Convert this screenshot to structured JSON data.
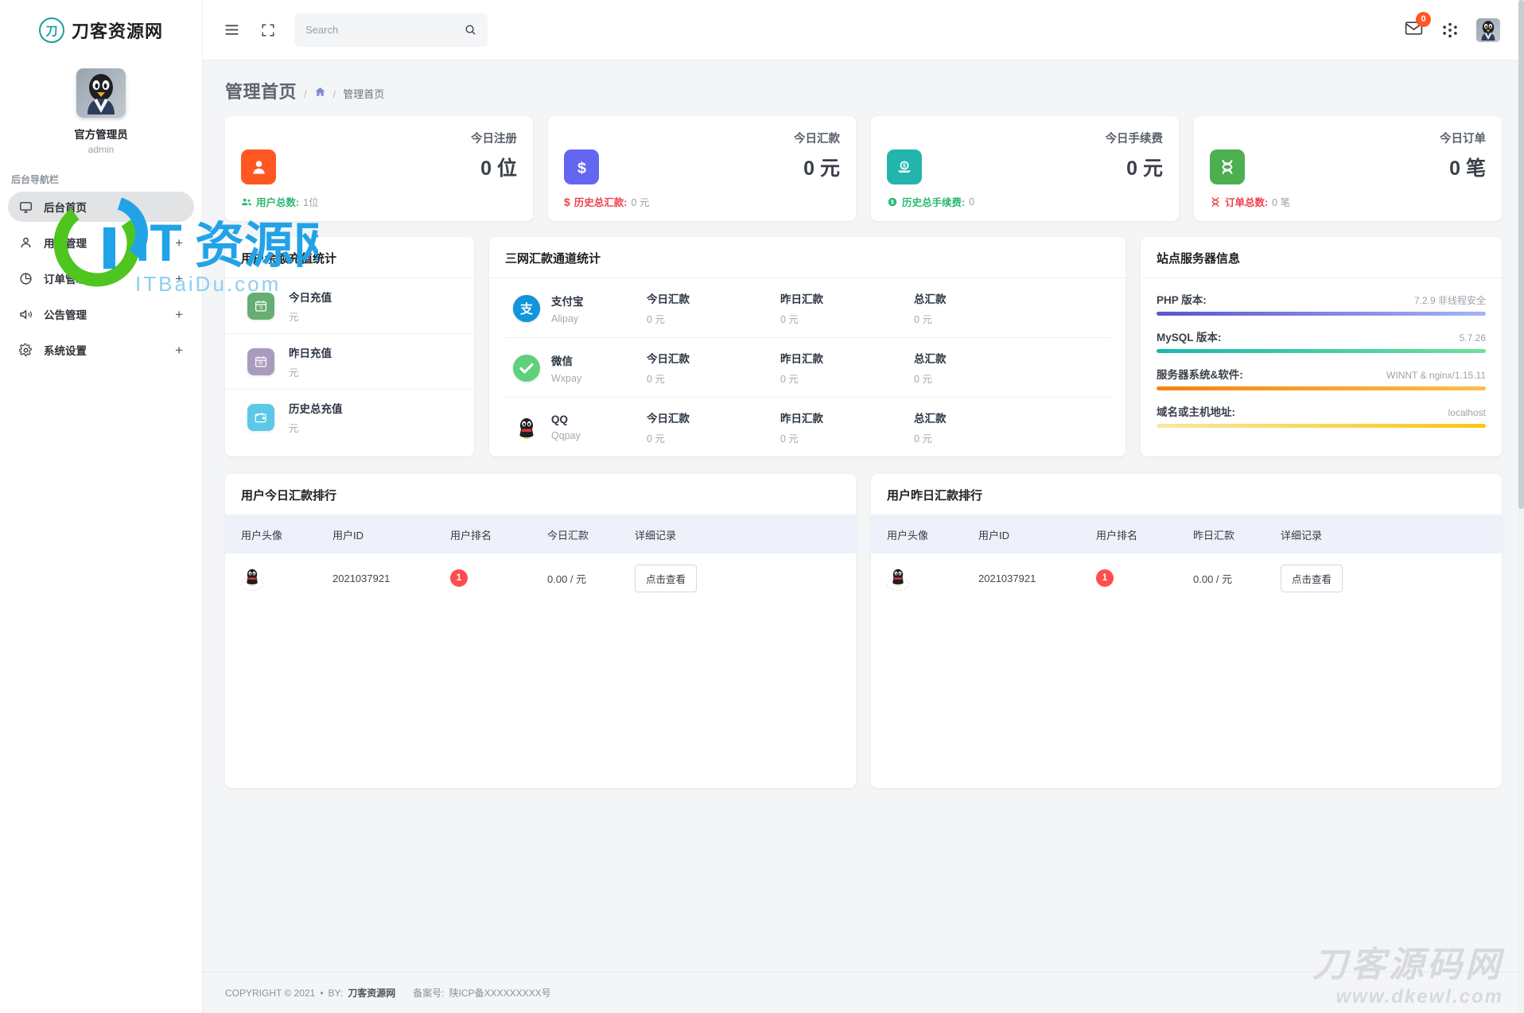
{
  "brand": {
    "name": "刀客资源网",
    "mark": "刀"
  },
  "profile": {
    "name": "官方管理员",
    "username": "admin"
  },
  "sidebar": {
    "nav_title": "后台导航栏",
    "items": [
      {
        "label": "后台首页",
        "icon": "monitor-icon",
        "expandable": false,
        "active": true
      },
      {
        "label": "用户管理",
        "icon": "user-icon",
        "expandable": true,
        "active": false
      },
      {
        "label": "订单管理",
        "icon": "pie-chart-icon",
        "expandable": true,
        "active": false
      },
      {
        "label": "公告管理",
        "icon": "megaphone-icon",
        "expandable": true,
        "active": false
      },
      {
        "label": "系统设置",
        "icon": "gear-icon",
        "expandable": true,
        "active": false
      }
    ],
    "expand_symbol": "+"
  },
  "topbar": {
    "menu_icon": "hamburger-icon",
    "fullscreen_icon": "fullscreen-icon",
    "search": {
      "placeholder": "Search",
      "value": "",
      "icon": "search-icon"
    },
    "mail": {
      "icon": "mail-icon",
      "badge": "0"
    },
    "apps_icon": "apps-icon",
    "avatar": "qq-penguin-avatar"
  },
  "page": {
    "title": "管理首页",
    "breadcrumb": {
      "home_icon": "home-icon",
      "sep": "/",
      "current": "管理首页"
    }
  },
  "stats": [
    {
      "label": "今日注册",
      "value": "0 位",
      "icon": "user-solid-icon",
      "color": "#ff5722",
      "foot_icon": "users-group-icon",
      "foot_label": "用户总数:",
      "foot_value": "1位",
      "foot_color": "#2eb872"
    },
    {
      "label": "今日汇款",
      "value": "0 元",
      "icon": "dollar-icon",
      "color": "#6366f1",
      "foot_icon": "dollar-sign-icon",
      "foot_label": "历史总汇款:",
      "foot_value": "0 元",
      "foot_color": "#f1404b"
    },
    {
      "label": "今日手续费",
      "value": "0 元",
      "icon": "coin-stack-icon",
      "color": "#23b5ad",
      "foot_icon": "coin-icon",
      "foot_label": "历史总手续费:",
      "foot_value": "0",
      "foot_color": "#2eb872"
    },
    {
      "label": "今日订单",
      "value": "0 笔",
      "icon": "dna-icon",
      "color": "#4caf50",
      "foot_icon": "dna-small-icon",
      "foot_label": "订单总数:",
      "foot_value": "0 笔",
      "foot_color": "#f1404b"
    }
  ],
  "recharge_card": {
    "title": "用户余额充值统计",
    "rows": [
      {
        "name": "今日充值",
        "unit": "元",
        "icon": "calendar-today-icon",
        "color": "#67ae72"
      },
      {
        "name": "昨日充值",
        "unit": "元",
        "icon": "calendar-yesterday-icon",
        "color": "#a99bbd"
      },
      {
        "name": "历史总充值",
        "unit": "元",
        "icon": "wallet-icon",
        "color": "#5bc8e8"
      }
    ]
  },
  "channel_card": {
    "title": "三网汇款通道统计",
    "columns": [
      "今日汇款",
      "昨日汇款",
      "总汇款"
    ],
    "rows": [
      {
        "name": "支付宝",
        "code": "Alipay",
        "logo": "alipay-icon",
        "color": "#1296db",
        "values": [
          "0 元",
          "0 元",
          "0 元"
        ]
      },
      {
        "name": "微信",
        "code": "Wxpay",
        "logo": "wechat-icon",
        "color": "#5ed07a",
        "values": [
          "0 元",
          "0 元",
          "0 元"
        ]
      },
      {
        "name": "QQ",
        "code": "Qqpay",
        "logo": "qq-penguin-icon",
        "color": "#ffffff",
        "values": [
          "0 元",
          "0 元",
          "0 元"
        ]
      }
    ]
  },
  "server_card": {
    "title": "站点服务器信息",
    "items": [
      {
        "key": "PHP 版本:",
        "value": "7.2.9 非线程安全",
        "bar_from": "#5b56c8",
        "bar_to": "#a6b4f5"
      },
      {
        "key": "MySQL 版本:",
        "value": "5.7.26",
        "bar_from": "#16b8b0",
        "bar_to": "#6ee09a"
      },
      {
        "key": "服务器系统&软件:",
        "value": "WINNT & nginx/1.15.11",
        "bar_from": "#f7820d",
        "bar_to": "#fcc04a"
      },
      {
        "key": "域名或主机地址:",
        "value": "localhost",
        "bar_from": "#f7e9a0",
        "bar_to": "#fbc513"
      }
    ]
  },
  "rank_today": {
    "title": "用户今日汇款排行",
    "columns": [
      "用户头像",
      "用户ID",
      "用户排名",
      "今日汇款",
      "详细记录"
    ],
    "rows": [
      {
        "avatar": "qq-penguin-avatar",
        "user_id": "2021037921",
        "rank": "1",
        "amount": "0.00 / 元",
        "action": "点击查看"
      }
    ]
  },
  "rank_yesterday": {
    "title": "用户昨日汇款排行",
    "columns": [
      "用户头像",
      "用户ID",
      "用户排名",
      "昨日汇款",
      "详细记录"
    ],
    "rows": [
      {
        "avatar": "qq-penguin-avatar",
        "user_id": "2021037921",
        "rank": "1",
        "amount": "0.00 / 元",
        "action": "点击查看"
      }
    ]
  },
  "footer": {
    "copyright": "COPYRIGHT © 2021",
    "dot": "•",
    "by_label": "BY:",
    "by_name": "刀客资源网",
    "icp_label": "备案号:",
    "icp_value": "陕ICP备XXXXXXXXX号"
  },
  "watermarks": {
    "it": {
      "text": "IT资源网",
      "sub": "ITBaiDu.com"
    },
    "dk": {
      "line1": "刀客源码网",
      "line2": "www.dkewl.com"
    }
  }
}
